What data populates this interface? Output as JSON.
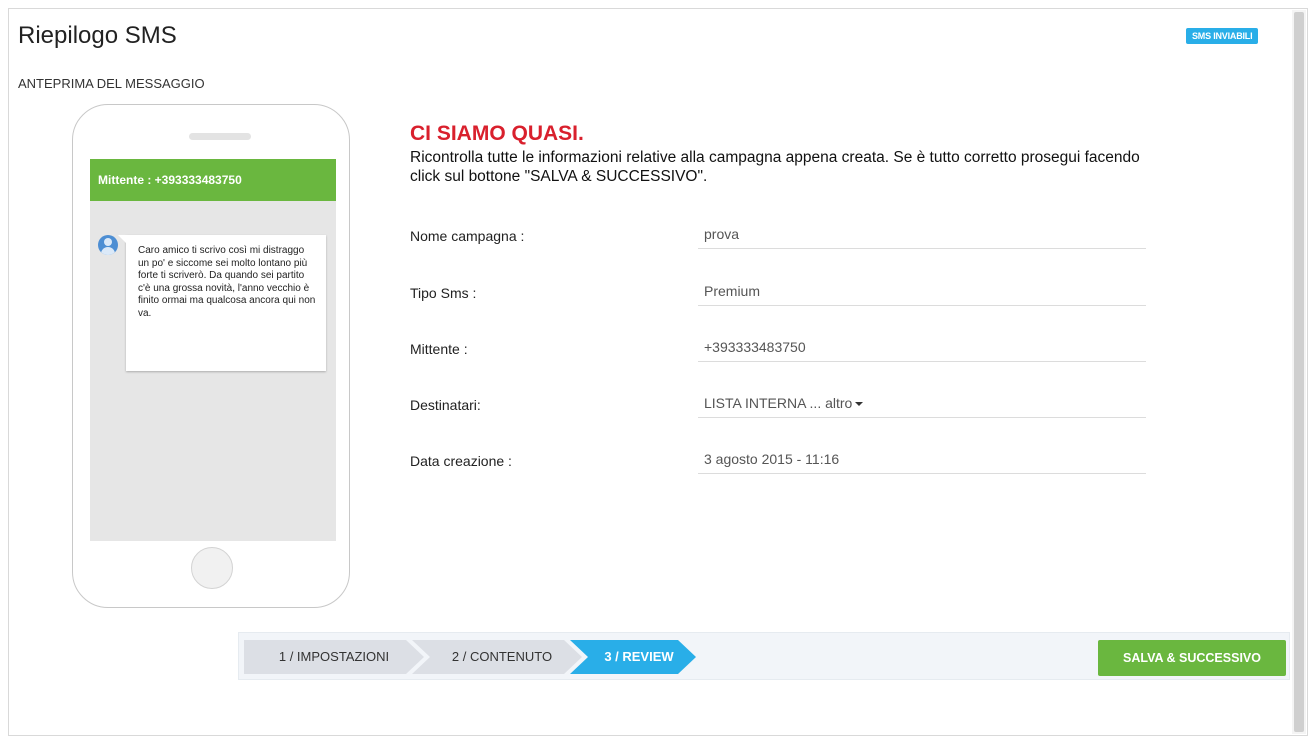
{
  "header": {
    "title": "Riepilogo SMS",
    "badge": "SMS INVIABILI"
  },
  "preview": {
    "section_label": "ANTEPRIMA DEL MESSAGGIO",
    "sender_bar": "Mittente : +393333483750",
    "message": "Caro amico ti scrivo così mi distraggo un po' e siccome sei molto lontano più forte ti scriverò. Da quando sei partito c'è una grossa novità, l'anno vecchio è finito ormai ma qualcosa ancora qui non va."
  },
  "review": {
    "headline": "CI SIAMO QUASI.",
    "intro": "Ricontrolla tutte le informazioni relative alla campagna appena creata. Se è tutto corretto prosegui facendo click sul bottone \"SALVA & SUCCESSIVO\".",
    "fields": [
      {
        "label": "Nome campagna :",
        "value": "prova"
      },
      {
        "label": "Tipo Sms :",
        "value": "Premium"
      },
      {
        "label": "Mittente :",
        "value": "+393333483750"
      },
      {
        "label": "Destinatari:",
        "value": "LISTA INTERNA ... altro"
      },
      {
        "label": "Data creazione :",
        "value": "3 agosto 2015 - 11:16"
      }
    ]
  },
  "wizard": {
    "steps": [
      {
        "label": "1 / IMPOSTAZIONI",
        "active": false
      },
      {
        "label": "2 / CONTENUTO",
        "active": false
      },
      {
        "label": "3 / REVIEW",
        "active": true
      }
    ],
    "save_label": "SALVA & SUCCESSIVO"
  },
  "colors": {
    "accent_blue": "#29aee8",
    "accent_green": "#6ab73f",
    "headline_red": "#d9202d"
  }
}
